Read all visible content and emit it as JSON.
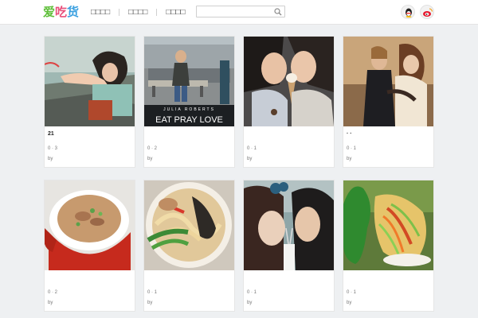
{
  "header": {
    "logo": {
      "c1": "爱",
      "c2": "吃",
      "c3": "货"
    },
    "nav": [
      "□□□□",
      "□□□□",
      "□□□□"
    ],
    "search": {
      "placeholder": ""
    },
    "social": [
      "qq-icon",
      "weibo-icon"
    ]
  },
  "cards": [
    {
      "title": "21",
      "stats": "0 · 3",
      "by": "by",
      "image": "woman-wind-hair-photo"
    },
    {
      "title": "",
      "stats": "0 · 2",
      "by": "by",
      "image": "eat-pray-love-poster",
      "poster_name": "JULIA ROBERTS",
      "poster_title": "EAT PRAY LOVE"
    },
    {
      "title": "",
      "stats": "0 · 1",
      "by": "by",
      "image": "two-girls-ice-cream-photo"
    },
    {
      "title": "·  ·",
      "stats": "0 · 1",
      "by": "by",
      "image": "titanic-couple-photo"
    },
    {
      "title": "",
      "stats": "0 · 2",
      "by": "by",
      "image": "soup-bowl-photo"
    },
    {
      "title": "",
      "stats": "0 · 1",
      "by": "by",
      "image": "ramen-bowl-photo"
    },
    {
      "title": "",
      "stats": "0 · 1",
      "by": "by",
      "image": "couple-milk-straw-photo"
    },
    {
      "title": "",
      "stats": "0 · 1",
      "by": "by",
      "image": "taco-plate-photo"
    }
  ],
  "colors": {
    "background": "#eef0f2",
    "logo1": "#5fbf3a",
    "logo2": "#e94f7a",
    "logo3": "#3aa0e0"
  }
}
